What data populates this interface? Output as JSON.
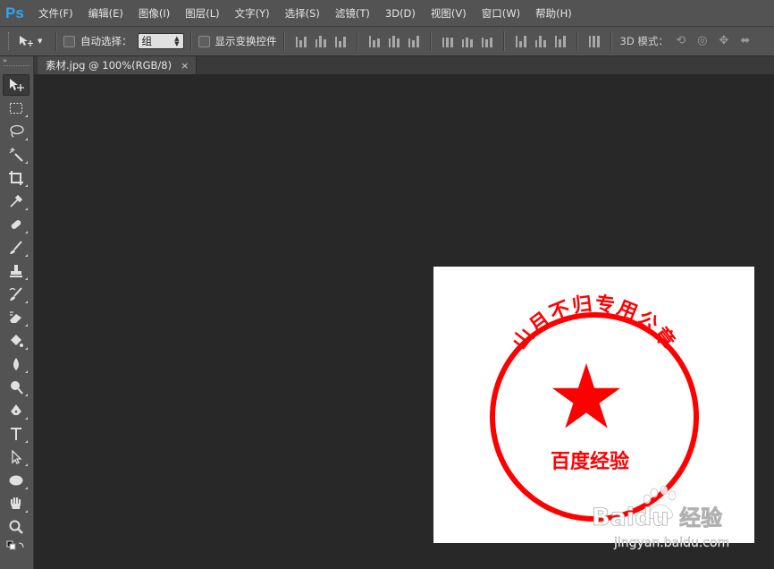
{
  "app": {
    "logo": "Ps",
    "brand_color": "#2fa3f7"
  },
  "menu": {
    "items": [
      "文件(F)",
      "编辑(E)",
      "图像(I)",
      "图层(L)",
      "文字(Y)",
      "选择(S)",
      "滤镜(T)",
      "3D(D)",
      "视图(V)",
      "窗口(W)",
      "帮助(H)"
    ]
  },
  "options": {
    "auto_select_label": "自动选择：",
    "auto_select_value": "组",
    "show_transform_label": "显示变换控件",
    "mode3d_label": "3D 模式："
  },
  "toolbox": {
    "header": "»",
    "tools": [
      "move-tool",
      "marquee-tool",
      "lasso-tool",
      "magic-wand-tool",
      "crop-tool",
      "eyedropper-tool",
      "healing-brush-tool",
      "brush-tool",
      "clone-stamp-tool",
      "history-brush-tool",
      "eraser-tool",
      "paint-bucket-tool",
      "blur-tool",
      "dodge-tool",
      "pen-tool",
      "type-tool",
      "path-selection-tool",
      "ellipse-tool",
      "hand-tool",
      "zoom-tool"
    ]
  },
  "document": {
    "tab_title": "素材.jpg @ 100%(RGB/8)",
    "close_glyph": "×"
  },
  "stamp": {
    "arc_text": "山月不归专用公章",
    "bottom_text": "百度经验",
    "color": "#ff0000"
  },
  "watermark": {
    "brand": "Baidu",
    "cn": "经验",
    "url": "jingyan.baidu.com"
  }
}
